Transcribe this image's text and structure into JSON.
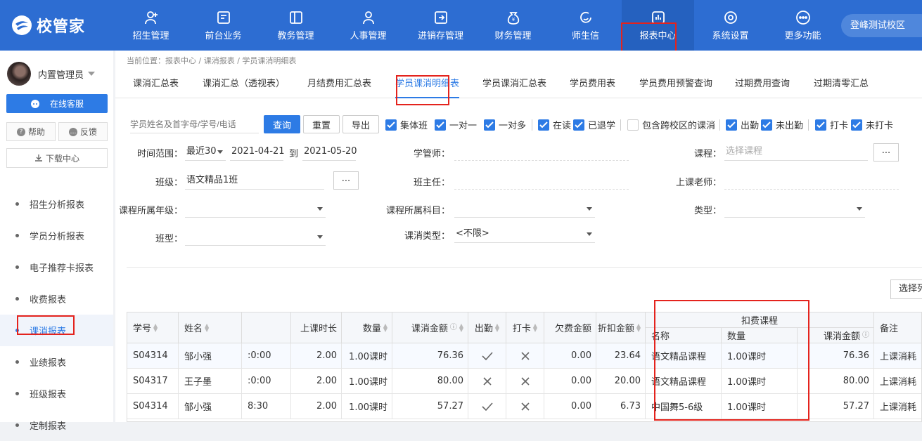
{
  "app": {
    "logo_text": "校管家",
    "campus": "登峰测试校区"
  },
  "nav": [
    {
      "label": "招生管理",
      "icon": "user-plus-icon"
    },
    {
      "label": "前台业务",
      "icon": "desk-icon"
    },
    {
      "label": "教务管理",
      "icon": "book-icon"
    },
    {
      "label": "人事管理",
      "icon": "person-icon"
    },
    {
      "label": "进销存管理",
      "icon": "inventory-icon"
    },
    {
      "label": "财务管理",
      "icon": "money-bag-icon"
    },
    {
      "label": "师生信",
      "icon": "message-icon"
    },
    {
      "label": "报表中心",
      "icon": "bar-chart-icon"
    },
    {
      "label": "系统设置",
      "icon": "settings-icon"
    },
    {
      "label": "更多功能",
      "icon": "more-icon"
    }
  ],
  "sidebar": {
    "user_name": "内置管理员",
    "service_label": "在线客服",
    "help_label": "帮助",
    "feedback_label": "反馈",
    "download_label": "下载中心",
    "items": [
      "招生分析报表",
      "学员分析报表",
      "电子推荐卡报表",
      "收费报表",
      "课消报表",
      "业绩报表",
      "班级报表",
      "定制报表"
    ]
  },
  "breadcrumb": "当前位置：报表中心 / 课消报表 / 学员课消明细表",
  "tabs": [
    "课消汇总表",
    "课消汇总（透视表）",
    "月结费用汇总表",
    "学员课消明细表",
    "学员课消汇总表",
    "学员费用表",
    "学员费用预警查询",
    "过期费用查询",
    "过期清零汇总"
  ],
  "filters": {
    "search_placeholder": "学员姓名及首字母/学号/电话",
    "query": "查询",
    "reset": "重置",
    "export": "导出",
    "checks": {
      "group": "集体班",
      "one_one": "一对一",
      "one_many": "一对多",
      "studying": "在读",
      "withdrawn": "已退学",
      "cross_campus": "包含跨校区的课消",
      "attended": "出勤",
      "absent": "未出勤",
      "checked_in": "打卡",
      "not_checked_in": "未打卡"
    },
    "time_label": "时间范围：",
    "time_range": "最近30",
    "date_from": "2021-04-21",
    "date_to_sep": "到",
    "date_to": "2021-05-20",
    "advisor_label": "学管师：",
    "course_label": "课程：",
    "course_placeholder": "选择课程",
    "class_label": "班级：",
    "class_value": "语文精品1班",
    "head_teacher_label": "班主任：",
    "teacher_label": "上课老师：",
    "grade_label": "课程所属年级：",
    "subject_label": "课程所属科目：",
    "type_label": "类型：",
    "class_type_label": "班型：",
    "consume_type_label": "课消类型：",
    "consume_type_value": "<不限>",
    "more": "...",
    "select_columns": "选择列"
  },
  "table": {
    "headers": {
      "student_no": "学号",
      "name": "姓名",
      "duration": "上课时长",
      "quantity": "数量",
      "amount": "课消金额",
      "attend": "出勤",
      "checkin": "打卡",
      "owed": "欠费金额",
      "discount": "折扣金额",
      "deduct_group": "扣费课程",
      "deduct_name": "名称",
      "deduct_qty": "数量",
      "deduct_amount": "课消金额",
      "remark": "备注"
    },
    "rows": [
      {
        "no": "S04314",
        "name": "邹小强",
        "time": ":0:00",
        "duration": "2.00",
        "qty": "1.00课时",
        "amount": "76.36",
        "attend": "check",
        "checkin": "cross",
        "owed": "0.00",
        "discount": "23.64",
        "course": "语文精品课程",
        "course_qty": "1.00课时",
        "course_amount": "76.36",
        "remark": "上课消耗"
      },
      {
        "no": "S04317",
        "name": "王子墨",
        "time": ":0:00",
        "duration": "2.00",
        "qty": "1.00课时",
        "amount": "80.00",
        "attend": "cross",
        "checkin": "cross",
        "owed": "0.00",
        "discount": "20.00",
        "course": "语文精品课程",
        "course_qty": "1.00课时",
        "course_amount": "80.00",
        "remark": "上课消耗"
      },
      {
        "no": "S04314",
        "name": "邹小强",
        "time": "8:30",
        "duration": "2.00",
        "qty": "1.00课时",
        "amount": "57.27",
        "attend": "check",
        "checkin": "cross",
        "owed": "0.00",
        "discount": "6.73",
        "course": "中国舞5-6级",
        "course_qty": "1.00课时",
        "course_amount": "57.27",
        "remark": "上课消耗"
      }
    ]
  },
  "colors": {
    "primary": "#2d6dd2",
    "accent": "#2d7be5",
    "highlight": "#e4231d"
  }
}
